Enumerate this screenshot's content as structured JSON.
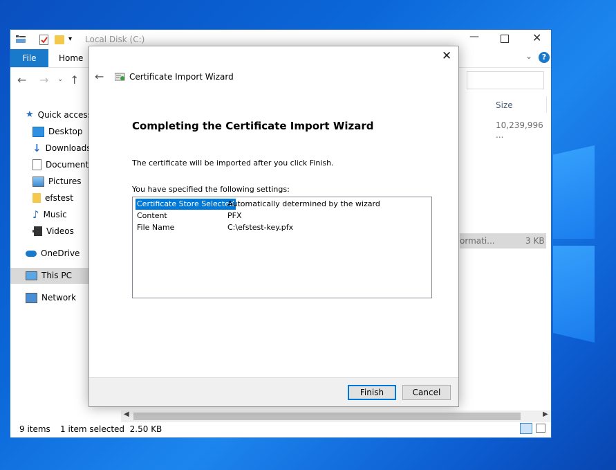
{
  "explorer": {
    "title": "Local Disk (C:)",
    "ribbon_tabs": [
      "File",
      "Home"
    ],
    "column_size": "Size",
    "row1_size": "10,239,996 ...",
    "row2_type": "ormati...",
    "row2_size": "3 KB",
    "sidebar": [
      {
        "label": "Quick access"
      },
      {
        "label": "Desktop"
      },
      {
        "label": "Downloads"
      },
      {
        "label": "Documents"
      },
      {
        "label": "Pictures"
      },
      {
        "label": "efstest"
      },
      {
        "label": "Music"
      },
      {
        "label": "Videos"
      },
      {
        "label": "OneDrive"
      },
      {
        "label": "This PC"
      },
      {
        "label": "Network"
      }
    ],
    "status_items": "9 items",
    "status_selected": "1 item selected  2.50 KB"
  },
  "dialog": {
    "title": "Certificate Import Wizard",
    "heading": "Completing the Certificate Import Wizard",
    "message": "The certificate will be imported after you click Finish.",
    "settings_label": "You have specified the following settings:",
    "settings": [
      {
        "key": "Certificate Store Selected",
        "value": "Automatically determined by the wizard"
      },
      {
        "key": "Content",
        "value": "PFX"
      },
      {
        "key": "File Name",
        "value": "C:\\efstest-key.pfx"
      }
    ],
    "finish_label": "Finish",
    "cancel_label": "Cancel"
  },
  "colors": {
    "accent": "#1979ca",
    "selection": "#0078d7",
    "desktop": "#0b67d8"
  }
}
